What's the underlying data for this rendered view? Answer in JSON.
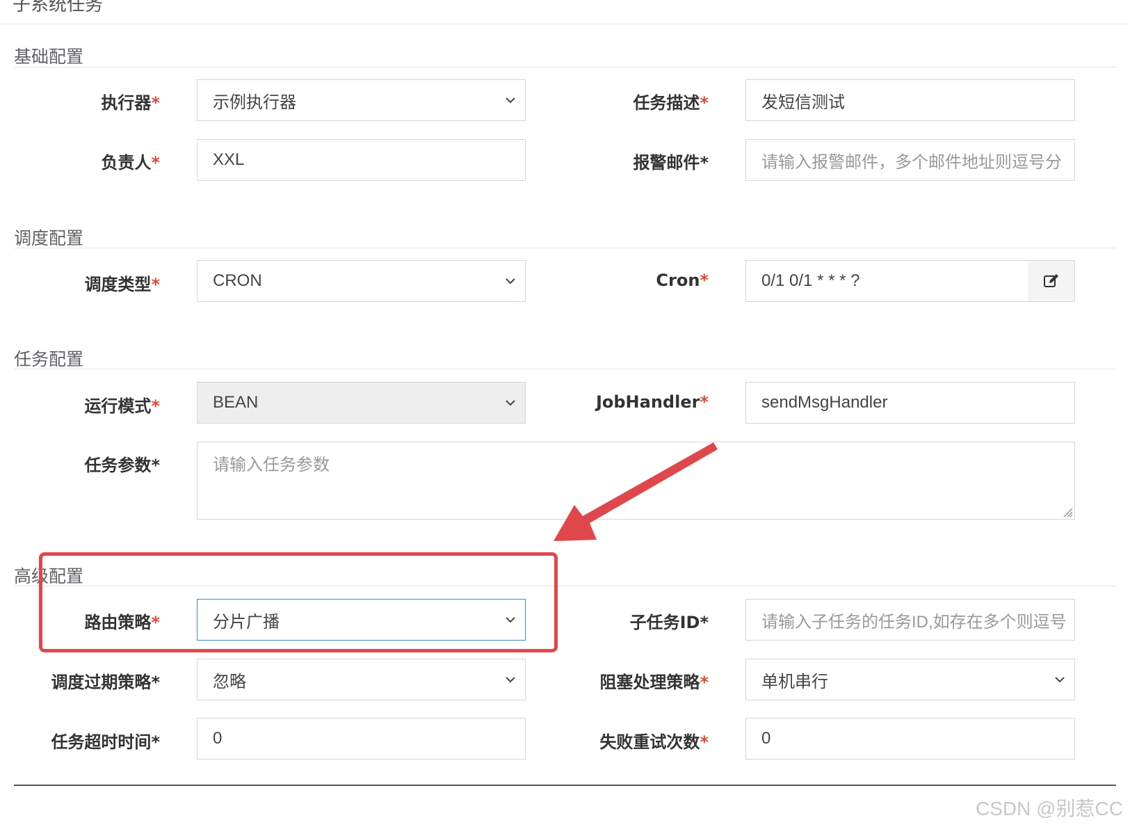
{
  "header": {
    "cut_title": "子系统任务"
  },
  "sections": {
    "basic": "基础配置",
    "schedule": "调度配置",
    "task": "任务配置",
    "advanced": "高级配置"
  },
  "fields": {
    "executor": {
      "label": "执行器",
      "value": "示例执行器"
    },
    "job_desc": {
      "label": "任务描述",
      "value": "发短信测试"
    },
    "author": {
      "label": "负责人",
      "value": "XXL"
    },
    "alarm_email": {
      "label": "报警邮件",
      "placeholder": "请输入报警邮件，多个邮件地址则逗号分"
    },
    "schedule_type": {
      "label": "调度类型",
      "value": "CRON"
    },
    "cron": {
      "label": "Cron",
      "value": "0/1 0/1 * * * ?"
    },
    "glue_type": {
      "label": "运行模式",
      "value": "BEAN"
    },
    "job_handler": {
      "label": "JobHandler",
      "value": "sendMsgHandler"
    },
    "job_param": {
      "label": "任务参数",
      "placeholder": "请输入任务参数"
    },
    "route_strategy": {
      "label": "路由策略",
      "value": "分片广播"
    },
    "child_job_id": {
      "label": "子任务ID",
      "placeholder": "请输入子任务的任务ID,如存在多个则逗号"
    },
    "misfire_strategy": {
      "label": "调度过期策略",
      "value": "忽略"
    },
    "block_strategy": {
      "label": "阻塞处理策略",
      "value": "单机串行"
    },
    "timeout": {
      "label": "任务超时时间",
      "value": "0"
    },
    "fail_retry": {
      "label": "失败重试次数",
      "value": "0"
    }
  },
  "required_mark": "*",
  "icons": {
    "select": "chevron-down-icon",
    "cron_edit": "edit-icon"
  },
  "colors": {
    "required": "#dd4b39",
    "annotation": "#e0474c",
    "focus_border": "#3c8dbc"
  },
  "watermark": "CSDN @别惹CC"
}
